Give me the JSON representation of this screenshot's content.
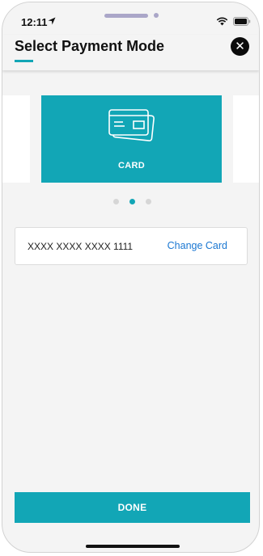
{
  "status_bar": {
    "time": "12:11",
    "icons": [
      "location-arrow-icon",
      "wifi-icon",
      "battery-icon"
    ]
  },
  "header": {
    "title": "Select Payment Mode",
    "close_icon": "close-icon",
    "close_glyph": "✕"
  },
  "carousel": {
    "active_card_label": "CARD",
    "active_card_icon": "credit-card-icon",
    "active_index": 1,
    "page_count": 3
  },
  "selected_card": {
    "number": "XXXX XXXX XXXX 1111",
    "change_label": "Change Card"
  },
  "done_label": "DONE",
  "colors": {
    "accent": "#12a6b6",
    "link": "#1a77d2",
    "background": "#f4f4f4",
    "dot_inactive": "#d6d6d6"
  }
}
